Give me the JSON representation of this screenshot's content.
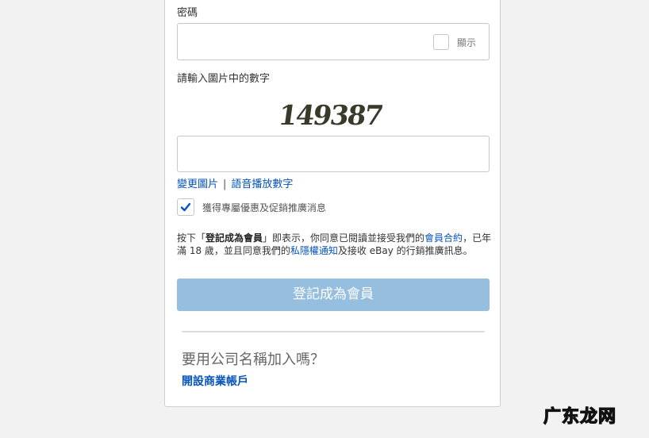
{
  "password": {
    "label": "密碼",
    "show_label": "顯示"
  },
  "captcha": {
    "label": "請輸入圖片中的數字",
    "image_text": "149387"
  },
  "captcha_links": {
    "change_image": "變更圖片",
    "separator": "|",
    "audio": "語音播放數字"
  },
  "promo": {
    "checked": true,
    "label": "獲得專屬優惠及促銷推廣消息"
  },
  "legal": {
    "prefix": "按下「",
    "button_name": "登記成為會員",
    "middle": "」即表示，你同意已閱讀並接受我們的",
    "user_agreement": "會員合約",
    "middle2": "，已年滿 18 歲，並且同意我們的",
    "privacy": "私隱權通知",
    "suffix": "及接收 eBay 的行銷推廣訊息。"
  },
  "submit": {
    "label": "登記成為會員"
  },
  "business": {
    "question": "要用公司名稱加入嗎？",
    "link": "開設商業帳戶"
  },
  "watermark": {
    "text": "广东龙网"
  },
  "colors": {
    "link": "#0654ba",
    "button_disabled": "#96bede",
    "checkmark": "#0654ba"
  }
}
